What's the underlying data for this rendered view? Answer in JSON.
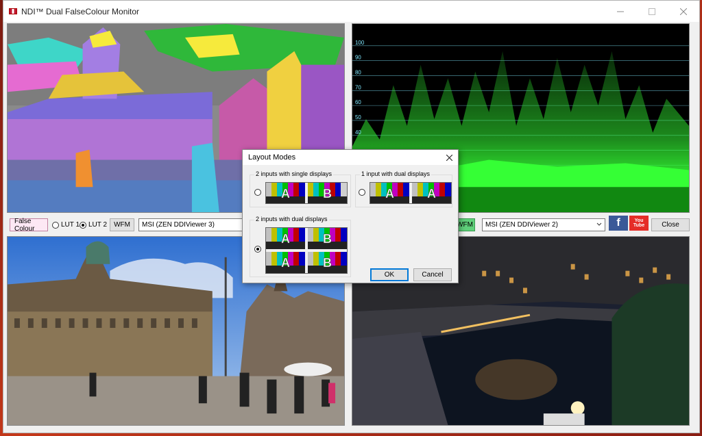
{
  "window": {
    "title": "NDI™ Dual FalseColour Monitor"
  },
  "controls_left": {
    "false_colour": "False Colour",
    "lut1": "LUT 1",
    "lut2": "LUT 2",
    "wfm": "WFM",
    "source": "MSI (ZEN DDIViewer 3)"
  },
  "controls_right": {
    "wfm": "WFM",
    "source": "MSI (ZEN DDIViewer 2)",
    "facebook": "f",
    "youtube": "You\nTube",
    "close": "Close"
  },
  "waveform": {
    "scale": [
      "100",
      "90",
      "80",
      "70",
      "60",
      "50",
      "40"
    ]
  },
  "dialog": {
    "title": "Layout Modes",
    "group1": "2 inputs with single displays",
    "group2": "1 input with dual displays",
    "group3": "2 inputs with dual displays",
    "tile_a": "A",
    "tile_b": "B",
    "ok": "OK",
    "cancel": "Cancel"
  },
  "colors": {
    "waveform_green": "#35ff35",
    "scale_cyan": "#7fe8ff"
  }
}
